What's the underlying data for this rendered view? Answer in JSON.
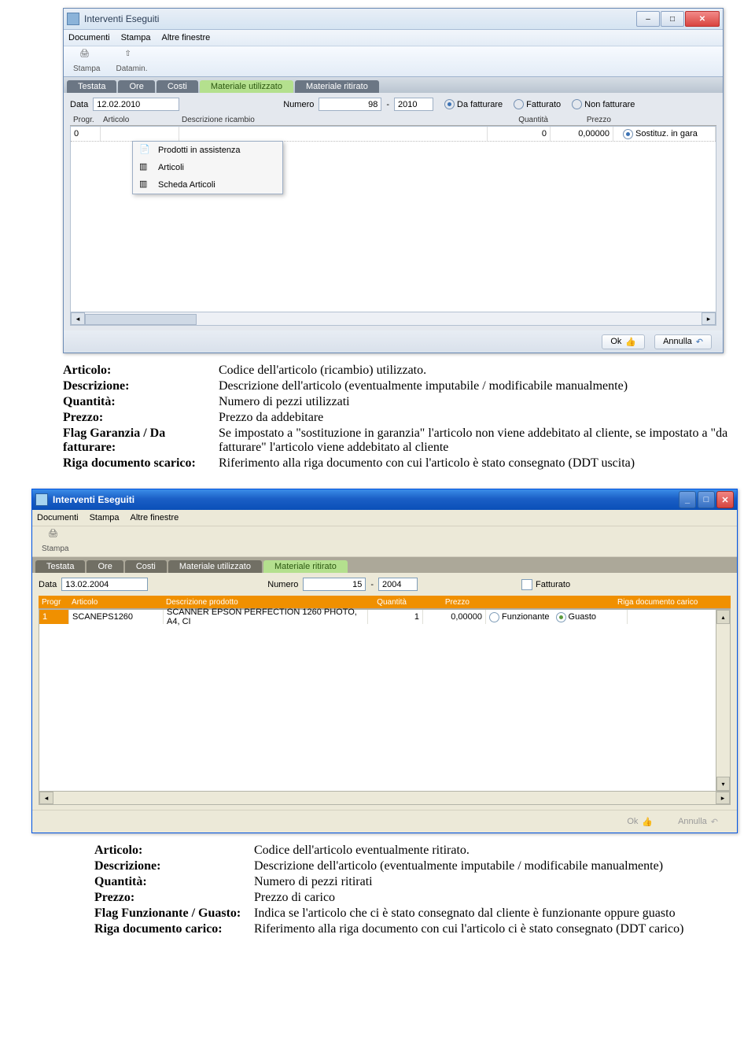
{
  "shot1": {
    "title": "Interventi Eseguiti",
    "menus": [
      "Documenti",
      "Stampa",
      "Altre finestre"
    ],
    "tools": [
      "Stampa",
      "Datamin."
    ],
    "tabs": [
      "Testata",
      "Ore",
      "Costi",
      "Materiale utilizzato",
      "Materiale ritirato"
    ],
    "active_tab": 3,
    "fields": {
      "data_label": "Data",
      "data_value": "12.02.2010",
      "numero_label": "Numero",
      "numero_value": "98",
      "anno_value": "2010",
      "radio_da_fatturare": "Da fatturare",
      "radio_fatturato": "Fatturato",
      "radio_non_fatturare": "Non fatturare"
    },
    "grid_headers": {
      "progr": "Progr.",
      "articolo": "Articolo",
      "descr": "Descrizione ricambio",
      "qta": "Quantità",
      "prezzo": "Prezzo",
      "sost": ""
    },
    "row": {
      "progr": "0",
      "articolo": "",
      "descr": "",
      "qta": "0",
      "prezzo": "0,00000",
      "sost": "Sostituz. in gara"
    },
    "context_menu": [
      "Prodotti in assistenza",
      "Articoli",
      "Scheda Articoli"
    ],
    "ok_label": "Ok",
    "annulla_label": "Annulla"
  },
  "defs1": [
    {
      "term": "Articolo:",
      "desc": "Codice dell'articolo (ricambio) utilizzato."
    },
    {
      "term": "Descrizione:",
      "desc": "Descrizione dell'articolo (eventualmente imputabile / modificabile manualmente)"
    },
    {
      "term": "Quantità:",
      "desc": "Numero di pezzi utilizzati"
    },
    {
      "term": "Prezzo:",
      "desc": "Prezzo da addebitare"
    },
    {
      "term": "Flag Garanzia / Da fatturare:",
      "desc": "Se impostato a \"sostituzione in garanzia\" l'articolo non viene addebitato al cliente, se impostato a \"da fatturare\" l'articolo viene addebitato al cliente"
    },
    {
      "term": "Riga documento scarico:",
      "desc": "Riferimento alla riga documento con cui l'articolo è stato consegnato (DDT uscita)"
    }
  ],
  "shot2": {
    "title": "Interventi Eseguiti",
    "menus": [
      "Documenti",
      "Stampa",
      "Altre finestre"
    ],
    "tools": [
      "Stampa"
    ],
    "tabs": [
      "Testata",
      "Ore",
      "Costi",
      "Materiale utilizzato",
      "Materiale ritirato"
    ],
    "active_tab": 4,
    "fields": {
      "data_label": "Data",
      "data_value": "13.02.2004",
      "numero_label": "Numero",
      "numero_value": "15",
      "anno_value": "2004",
      "fatturato_label": "Fatturato"
    },
    "grid_headers": {
      "progr": "Progr",
      "articolo": "Articolo",
      "descr": "Descrizione prodotto",
      "qta": "Quantità",
      "prezzo": "Prezzo",
      "stato": "",
      "rdc": "Riga documento carico"
    },
    "row": {
      "progr": "1",
      "articolo": "SCANEPS1260",
      "descr": "SCANNER EPSON PERFECTION 1260 PHOTO, A4, CI",
      "qta": "1",
      "prezzo": "0,00000",
      "radio_funz": "Funzionante",
      "radio_guasto": "Guasto",
      "rdc": ""
    },
    "ok_label": "Ok",
    "annulla_label": "Annulla"
  },
  "defs2": [
    {
      "term": "Articolo:",
      "desc": "Codice dell'articolo eventualmente ritirato."
    },
    {
      "term": "Descrizione:",
      "desc": "Descrizione dell'articolo (eventualmente imputabile / modificabile manualmente)"
    },
    {
      "term": "Quantità:",
      "desc": "Numero di pezzi ritirati"
    },
    {
      "term": "Prezzo:",
      "desc": "Prezzo di carico"
    },
    {
      "term": "Flag Funzionante / Guasto:",
      "desc": "Indica se l'articolo che ci è stato consegnato dal cliente è funzionante oppure guasto"
    },
    {
      "term": "Riga documento carico:",
      "desc": "Riferimento alla riga documento con cui l'articolo ci è stato consegnato (DDT carico)"
    }
  ]
}
